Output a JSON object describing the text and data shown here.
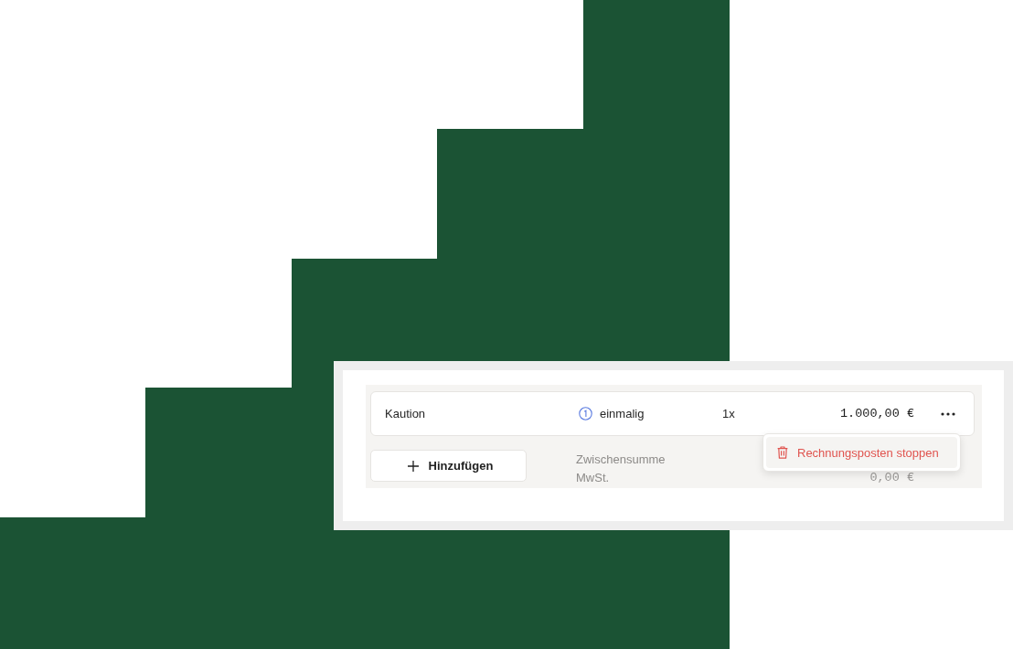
{
  "line_items": [
    {
      "name": "Kaution",
      "frequency": "einmalig",
      "quantity": "1x",
      "amount": "1.000,00 €"
    }
  ],
  "add_button": {
    "label": "Hinzufügen"
  },
  "summary": [
    {
      "label": "Zwischensumme"
    },
    {
      "label": "MwSt.",
      "amount": "0,00 €"
    }
  ],
  "context_menu": {
    "items": [
      {
        "label": "Rechnungsposten stoppen",
        "kind": "danger"
      }
    ]
  }
}
